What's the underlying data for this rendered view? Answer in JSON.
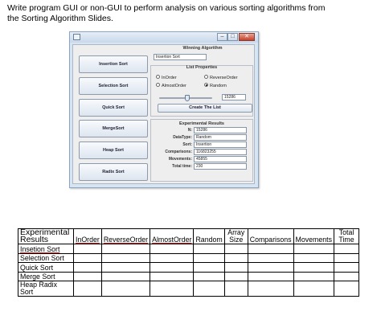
{
  "instructions": "Write program GUI or non-GUI to perform analysis on various sorting algorithms from the Sorting Algorithm Slides.",
  "window": {
    "sort_buttons": [
      "Insertion Sort",
      "Selection Sort",
      "Quick Sort",
      "MergeSort",
      "Heap Sort",
      "Radix Sort"
    ],
    "winning": {
      "label": "Winning Algorithm",
      "value": "Insertion Sort"
    },
    "list_properties": {
      "label": "List Properties",
      "radios": [
        {
          "label": "InOrder",
          "selected": false
        },
        {
          "label": "ReverseOrder",
          "selected": false
        },
        {
          "label": "AlmostOrder",
          "selected": false
        },
        {
          "label": "Random",
          "selected": true
        }
      ],
      "size_value": "15286",
      "create_button": "Create The List"
    },
    "results": {
      "label": "Experimental Results",
      "rows": [
        {
          "label": "N:",
          "value": "15286"
        },
        {
          "label": "DataType:",
          "value": "Random"
        },
        {
          "label": "Sort:",
          "value": "Insertion"
        },
        {
          "label": "Comparisons:",
          "value": "116823255"
        },
        {
          "label": "Movements:",
          "value": "45855"
        },
        {
          "label": "Total time:",
          "value": "230"
        }
      ]
    }
  },
  "table": {
    "header_title": "Experimental Results",
    "columns": [
      "InOrder",
      "ReverseOrder",
      "AlmostOrder",
      "Random",
      "Array Size",
      "Comparisons",
      "Movements",
      "Total Time"
    ],
    "rows": [
      "Insetion Sort",
      "Selection Sort",
      "Quick Sort",
      "Merge Sort",
      "Heap Radix Sort"
    ]
  }
}
